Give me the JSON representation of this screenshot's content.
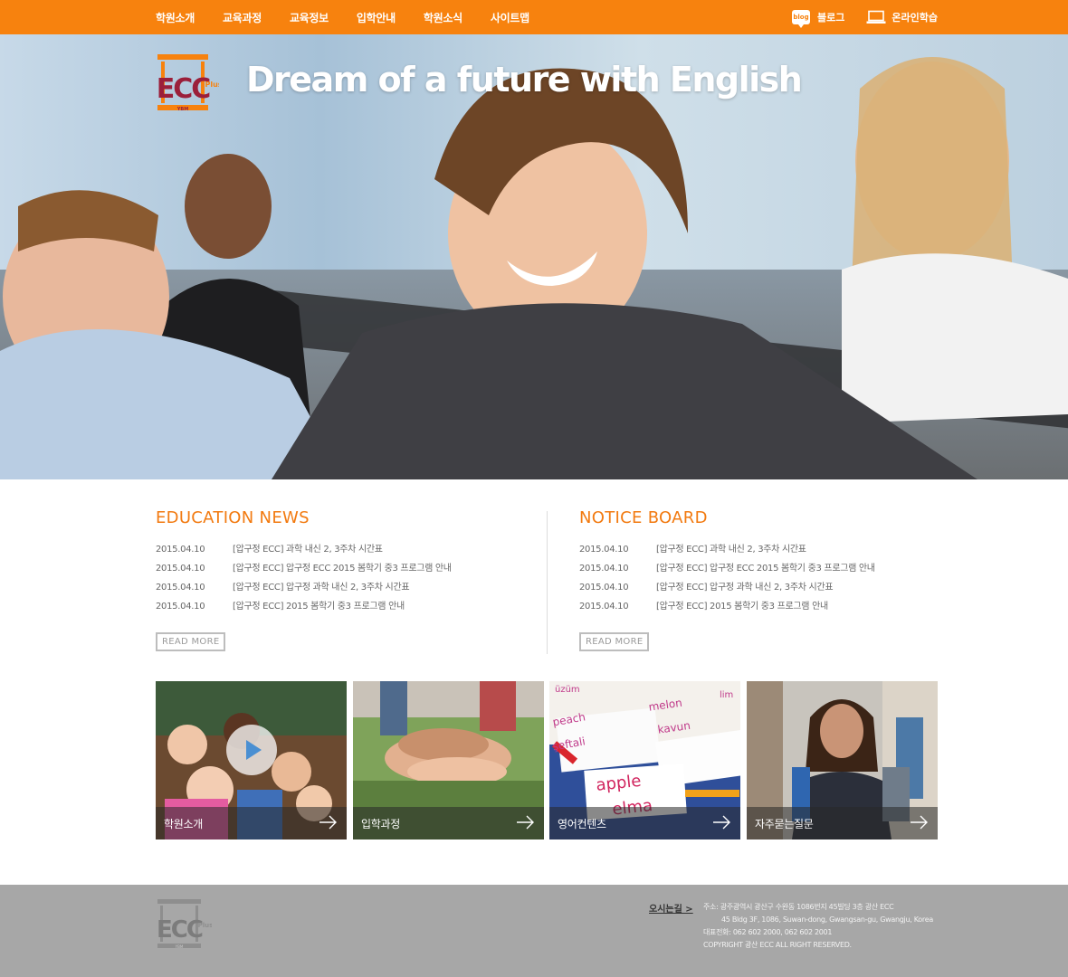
{
  "nav": {
    "items": [
      "학원소개",
      "교육과정",
      "교육정보",
      "입학안내",
      "학원소식",
      "사이트맵"
    ],
    "blog_badge": "blog",
    "blog_label": "블로그",
    "online_label": "온라인학습"
  },
  "hero": {
    "logo_text": "ECC",
    "logo_sub": "Plus",
    "logo_tag": "YBM",
    "title": "Dream of a future with English"
  },
  "education_news": {
    "heading": "EDUCATION NEWS",
    "items": [
      {
        "date": "2015.04.10",
        "title": "[압구정 ECC] 과학 내신 2, 3주차 시간표"
      },
      {
        "date": "2015.04.10",
        "title": "[압구정 ECC] 압구정 ECC 2015 봄학기 중3 프로그램 안내"
      },
      {
        "date": "2015.04.10",
        "title": "[압구정 ECC] 압구정 과학 내신 2, 3주차 시간표"
      },
      {
        "date": "2015.04.10",
        "title": "[압구정 ECC] 2015 봄학기 중3 프로그램 안내"
      }
    ],
    "read_more": "READ MORE"
  },
  "notice_board": {
    "heading": "NOTICE BOARD",
    "items": [
      {
        "date": "2015.04.10",
        "title": "[압구정 ECC] 과학 내신 2, 3주차 시간표"
      },
      {
        "date": "2015.04.10",
        "title": "[압구정 ECC] 압구정 ECC 2015 봄학기 중3 프로그램 안내"
      },
      {
        "date": "2015.04.10",
        "title": "[압구정 ECC] 압구정 과학 내신 2, 3주차 시간표"
      },
      {
        "date": "2015.04.10",
        "title": "[압구정 ECC] 2015 봄학기 중3 프로그램 안내"
      }
    ],
    "read_more": "READ MORE"
  },
  "tiles": [
    {
      "label": "학원소개"
    },
    {
      "label": "입학과정"
    },
    {
      "label": "영어컨텐츠"
    },
    {
      "label": "자주묻는질문"
    }
  ],
  "tile_cards": {
    "words": [
      "üzüm",
      "lim",
      "peach",
      "melon",
      "şeftali",
      "kavun",
      "apple",
      "elma"
    ]
  },
  "footer": {
    "directions": "오시는길 >",
    "address_ko": "주소: 광주광역시 광산구 수완동 1086번지 45빌딩 3층 광산 ECC",
    "address_en": "45 Bldg 3F, 1086, Suwan-dong, Gwangsan-gu, Gwangju, Korea",
    "phone": "대표전화: 062 602 2000, 062 602 2001",
    "copyright": "COPYRIGHT 광산 ECC ALL RIGHT RESERVED."
  },
  "colors": {
    "brand_orange": "#f7820e",
    "heading_orange": "#f27a10",
    "logo_maroon": "#9b1f3a",
    "footer_gray": "#a7a7a7"
  }
}
